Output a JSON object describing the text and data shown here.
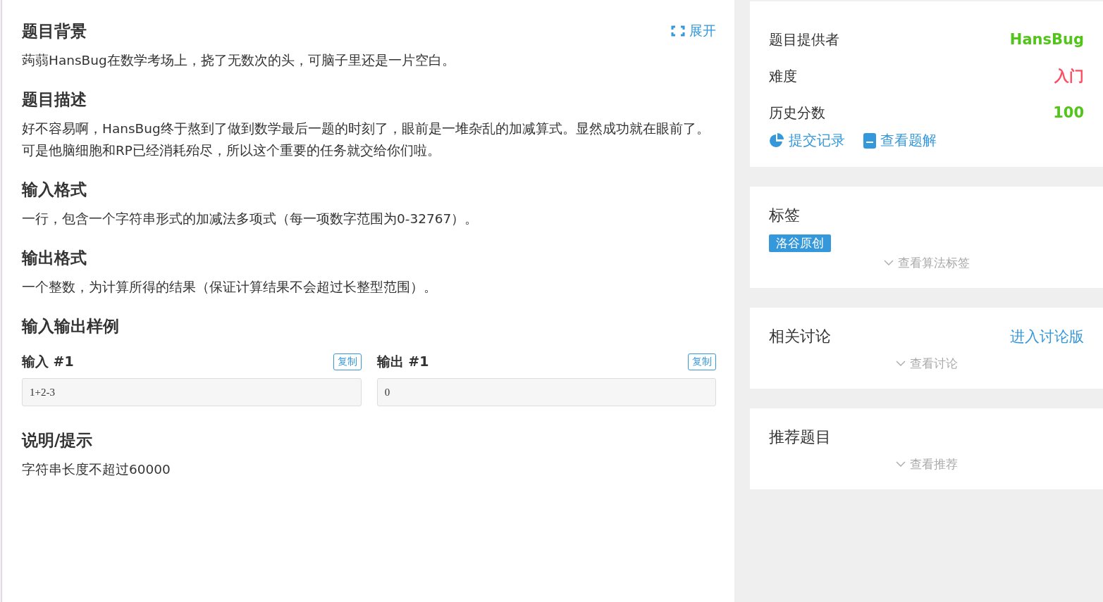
{
  "problem": {
    "expand_link": "展开",
    "sections": [
      {
        "kind": "text",
        "title": "题目背景",
        "paragraphs": [
          "蒟蒻HansBug在数学考场上，挠了无数次的头，可脑子里还是一片空白。"
        ]
      },
      {
        "kind": "text",
        "title": "题目描述",
        "paragraphs": [
          "好不容易啊，HansBug终于熬到了做到数学最后一题的时刻了，眼前是一堆杂乱的加减算式。显然成功就在眼前了。可是他脑细胞和RP已经消耗殆尽，所以这个重要的任务就交给你们啦。"
        ]
      },
      {
        "kind": "text",
        "title": "输入格式",
        "paragraphs": [
          "一行，包含一个字符串形式的加减法多项式（每一项数字范围为0-32767）。"
        ]
      },
      {
        "kind": "text",
        "title": "输出格式",
        "paragraphs": [
          "一个整数，为计算所得的结果（保证计算结果不会超过长整型范围）。"
        ]
      },
      {
        "kind": "samples",
        "title": "输入输出样例",
        "samples": [
          {
            "label": "输入 #1",
            "copy": "复制",
            "value": "1+2-3"
          },
          {
            "label": "输出 #1",
            "copy": "复制",
            "value": "0"
          }
        ]
      },
      {
        "kind": "text",
        "title": "说明/提示",
        "paragraphs": [
          "字符串长度不超过60000"
        ]
      }
    ]
  },
  "sidebar": {
    "info": {
      "rows": [
        {
          "label": "题目提供者",
          "value": "HansBug",
          "color": "#52c41a"
        },
        {
          "label": "难度",
          "value": "入门",
          "color": "#fe4c61"
        },
        {
          "label": "历史分数",
          "value": "100",
          "color": "#52c41a"
        }
      ],
      "links": [
        {
          "kind": "chart",
          "label": "提交记录"
        },
        {
          "kind": "book",
          "label": "查看题解"
        }
      ]
    },
    "tags": {
      "title": "标签",
      "tags": [
        {
          "label": "洛谷原创",
          "color": "#3498db"
        }
      ],
      "more": "查看算法标签"
    },
    "discuss": {
      "title": "相关讨论",
      "link": "进入讨论版",
      "more": "查看讨论"
    },
    "recommend": {
      "title": "推荐题目",
      "more": "查看推荐"
    }
  }
}
